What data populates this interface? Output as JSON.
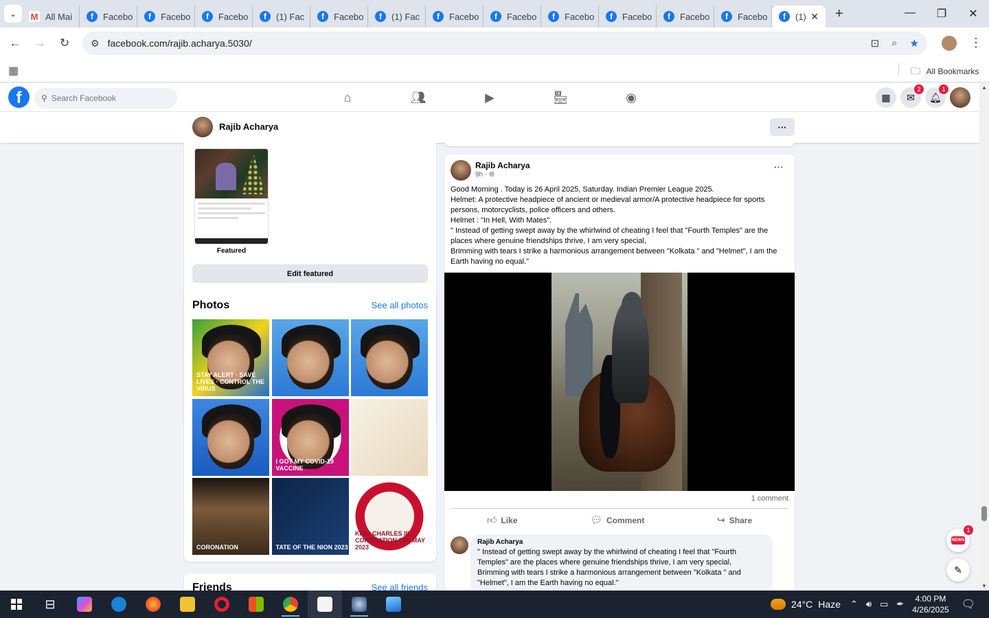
{
  "browser": {
    "tabs": [
      {
        "label": "All Mai",
        "icon": "gmail-icon"
      },
      {
        "label": "Facebo",
        "icon": "facebook-icon"
      },
      {
        "label": "Facebo",
        "icon": "facebook-icon"
      },
      {
        "label": "Facebo",
        "icon": "facebook-icon"
      },
      {
        "label": "(1) Fac",
        "icon": "facebook-icon"
      },
      {
        "label": "Facebo",
        "icon": "facebook-icon"
      },
      {
        "label": "(1) Fac",
        "icon": "facebook-icon"
      },
      {
        "label": "Facebo",
        "icon": "facebook-icon"
      },
      {
        "label": "Facebo",
        "icon": "facebook-icon"
      },
      {
        "label": "Facebo",
        "icon": "facebook-icon"
      },
      {
        "label": "Facebo",
        "icon": "facebook-icon"
      },
      {
        "label": "Facebo",
        "icon": "facebook-icon"
      },
      {
        "label": "Facebo",
        "icon": "facebook-icon"
      }
    ],
    "active_tab": {
      "label": "(1)",
      "icon": "facebook-icon"
    },
    "url": "facebook.com/rajib.acharya.5030/",
    "bookmarks_label": "All Bookmarks"
  },
  "fb": {
    "logo_letter": "f",
    "search_placeholder": "Search Facebook",
    "messenger_badge": "2",
    "notifications_badge": "1",
    "accent": "#1877f2"
  },
  "profile": {
    "name": "Rajib Acharya",
    "more": "···"
  },
  "featured": {
    "label": "Featured",
    "edit_button": "Edit featured"
  },
  "photos": {
    "title": "Photos",
    "see_all": "See all photos",
    "items": [
      {
        "caption": "STAY ALERT · SAVE LIVES · CONTROL THE VIRUS"
      },
      {
        "caption": ""
      },
      {
        "caption": ""
      },
      {
        "caption": ""
      },
      {
        "caption": "I GOT MY COVID-19 VACCINE"
      },
      {
        "caption": ""
      },
      {
        "caption": "CORONATION"
      },
      {
        "caption": "TATE OF THE NION 2023"
      },
      {
        "caption": "KING CHARLES III CORONATION 6TH MAY 2023"
      }
    ]
  },
  "friends": {
    "title": "Friends",
    "see_all": "See all friends"
  },
  "post": {
    "author": "Rajib Acharya",
    "time": "9h ·",
    "text": "Good Morning . Today is 26 April 2025, Saturday. Indian Premier League 2025.\nHelmet: A protective headpiece of ancient or medieval armor/A protective headpiece for sports persons, motorcyclists, police officers and others.\nHelmet : \"In Hell, With Mates\".\n\" Instead of getting swept away by the whirlwind of cheating I feel that \"Fourth Temples\" are the places where genuine friendships thrive, I am very special,\nBrimming with tears I strike a harmonious arrangement between \"Kolkata \" and \"Helmet\", I am the Earth having no equal.\"",
    "comment_count": "1 comment",
    "like": "Like",
    "comment": "Comment",
    "share": "Share",
    "comment_author": "Rajib Acharya",
    "comment_text": "\" Instead of getting swept away by the whirlwind of cheating I feel that \"Fourth Temples\" are the places where genuine friendships thrive, I am very special,\nBrimming with tears I strike a harmonious arrangement between \"Kolkata \" and \"Helmet\", I am the Earth having no equal.\""
  },
  "floaters": {
    "news_badge": "1",
    "news_label": "NEWS"
  },
  "taskbar": {
    "temperature": "24°C",
    "condition": "Haze",
    "time": "4:00 PM",
    "date": "4/26/2025"
  }
}
